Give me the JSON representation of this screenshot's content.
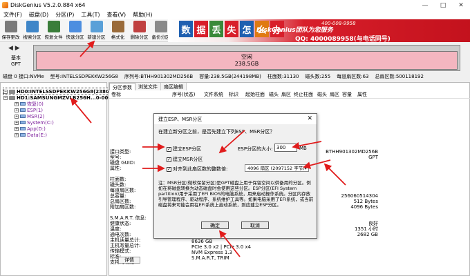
{
  "window": {
    "title": "DiskGenius V5.2.0.884 x64"
  },
  "menu": [
    "文件(F)",
    "磁盘(D)",
    "分区(P)",
    "工具(T)",
    "查看(V)",
    "帮助(H)"
  ],
  "toolbar": [
    {
      "label": "保存更改",
      "icon": "save-icon",
      "color": "#7a7a7a"
    },
    {
      "label": "搜索分区",
      "icon": "search-icon",
      "color": "#3f86c8"
    },
    {
      "label": "恢复文件",
      "icon": "recover-icon",
      "color": "#3a7d3a"
    },
    {
      "label": "快速分区",
      "icon": "quick-partition-icon",
      "color": "#4d8ee0"
    },
    {
      "label": "新建分区",
      "icon": "new-partition-icon",
      "color": "#5aa0d8"
    },
    {
      "label": "格式化",
      "icon": "format-icon",
      "color": "#9a6b3a"
    },
    {
      "label": "删除分区",
      "icon": "delete-icon",
      "color": "#c04040"
    },
    {
      "label": "备份分区",
      "icon": "backup-icon",
      "color": "#8a8a8a"
    }
  ],
  "banner": {
    "chars": [
      "数",
      "据",
      "丢",
      "失",
      "怎",
      "么",
      "办"
    ],
    "title": "DiskGenius团队为您服务",
    "phone": "400-008-9958",
    "qq": "QQ: 4000089958(与电话同号)"
  },
  "disk_map": {
    "label": "基本\nGPT",
    "partition_name": "空闲",
    "partition_size": "238.5GB"
  },
  "disk_info": [
    "磁盘 0 接口:NVMe",
    "型号:INTELSSDPEKKW256G8",
    "序列号:BTHH901302MD256B",
    "容量:238.5GB(244198MB)",
    "柱面数:31130",
    "磁头数:255",
    "每道扇区数:63",
    "总扇区数:500118192"
  ],
  "tree": [
    {
      "label": "HD0:INTELSSDPEKKW256G8(238GB)",
      "type": "disk",
      "expand": "−"
    },
    {
      "label": "HD1:SAMSUNGMZVLB256H...0-00000(23",
      "type": "disk",
      "expand": "−"
    },
    {
      "label": "恢复(0)",
      "type": "part",
      "expand": "+"
    },
    {
      "label": "ESP(1)",
      "type": "part",
      "expand": "+"
    },
    {
      "label": "MSR(2)",
      "type": "part",
      "expand": "+"
    },
    {
      "label": "System(C:)",
      "type": "part",
      "expand": "+"
    },
    {
      "label": "App(D:)",
      "type": "part",
      "expand": "+"
    },
    {
      "label": "Data(E:)",
      "type": "part",
      "expand": "+"
    }
  ],
  "tabs": [
    "分区参数",
    "浏览文件",
    "扇区编辑"
  ],
  "columns": [
    "卷标",
    "序号(状态)",
    "文件系统",
    "标识",
    "起始柱面",
    "磁头",
    "扇区",
    "终止柱面",
    "磁头",
    "扇区",
    "容量",
    "属性"
  ],
  "props_left": [
    "接口类型:",
    "型号:",
    "磁盘 GUID:",
    "属性:",
    "",
    "柱面数:",
    "磁头数:",
    "每道扇区数:",
    "总容量:",
    "总扇区数:",
    "附加扇区数:",
    "",
    "S.M.A.R.T. 信息:",
    "健康状态:",
    "温度:",
    "通电次数:",
    "主机读量总计:",
    "主机写量总计:",
    "传输模式:",
    "标准:",
    "支持的功能:"
  ],
  "props_right": [
    "BTHH901302MD256B",
    "GPT",
    "",
    "",
    "",
    "",
    "",
    "",
    "256060514304",
    "512 Bytes",
    "4096 Bytes",
    "",
    "",
    "良好",
    "1351 小时",
    "2682 GB",
    "",
    "",
    "",
    "",
    ""
  ],
  "props_mid": [
    "8636 GB",
    "PCIe 3.0 x2 | PCIe 3.0 x4",
    "NVM Express 1.3",
    "S.M.A.R.T, TRIM"
  ],
  "smart_button": "详情",
  "dialog": {
    "title": "建立ESP、MSR分区",
    "question": "在建立新分区之前，是否先建立下列ESP、MSR分区？",
    "esp_label": "建立ESP分区",
    "esp_size_label": "ESP分区的大小:",
    "esp_size": "300",
    "unit": "MB",
    "msr_label": "建立MSR分区",
    "align_label": "对齐到此扇区数的整数倍:",
    "align_value": "4096 扇区 (2097152 字节)",
    "note": "注：MSR分区(微软保留分区)是GPT磁盘上用于保留空间以供备用的分区。例如在将磁盘转换为动态磁盘时会使用这些分区。ESP分区(EFI System partition)用于采用了EFI BIOS的电脑系统，用来启动操作系统。分区内存放引导管理程序、驱动程序、系统维护工具等。如果电脑采用了EFI系统，或当前磁盘将来可能会用在EFI系统上启动系统，则应建立ESP分区。",
    "ok": "确定",
    "cancel": "取消"
  }
}
